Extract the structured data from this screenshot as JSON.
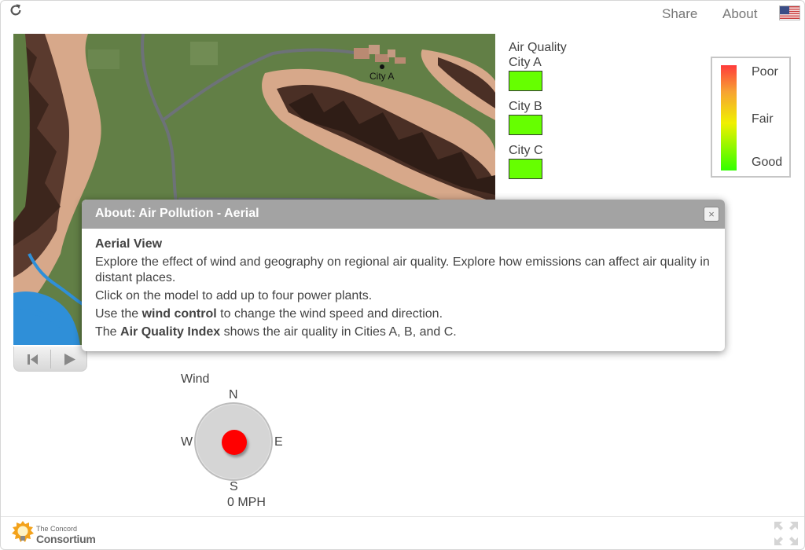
{
  "header": {
    "share_label": "Share",
    "about_label": "About",
    "reload_icon": "reload-icon",
    "language_flag": "us-flag-icon"
  },
  "map": {
    "city_a_label": "City A"
  },
  "air_quality": {
    "title": "Air Quality",
    "cities": [
      {
        "label": "City A",
        "color": "#66ff00"
      },
      {
        "label": "City B",
        "color": "#66ff00"
      },
      {
        "label": "City C",
        "color": "#66ff00"
      }
    ]
  },
  "legend": {
    "poor": "Poor",
    "fair": "Fair",
    "good": "Good",
    "colors": {
      "poor": "#ff3b3b",
      "fair": "#f0f000",
      "good": "#33ff00"
    }
  },
  "wind": {
    "title": "Wind",
    "north": "N",
    "south": "S",
    "east": "E",
    "west": "W",
    "speed": "0 MPH",
    "knob_color": "#ff0000"
  },
  "playback": {
    "reset_icon": "reset-icon",
    "play_icon": "play-icon"
  },
  "dialog": {
    "title": "About: Air Pollution - Aerial",
    "close_label": "×",
    "heading": "Aerial View",
    "para1": "Explore the effect of wind and geography on regional air quality. Explore how emissions can affect air quality in distant places.",
    "para2": "Click on the model to add up to four power plants.",
    "para3_pre": "Use the ",
    "para3_bold": "wind control",
    "para3_post": " to change the wind speed and direction.",
    "para4_pre": "The ",
    "para4_bold": "Air Quality Index",
    "para4_post": " shows the air quality in Cities A, B, and C."
  },
  "footer": {
    "logo_line1": "The Concord",
    "logo_line2": "Consortium"
  }
}
